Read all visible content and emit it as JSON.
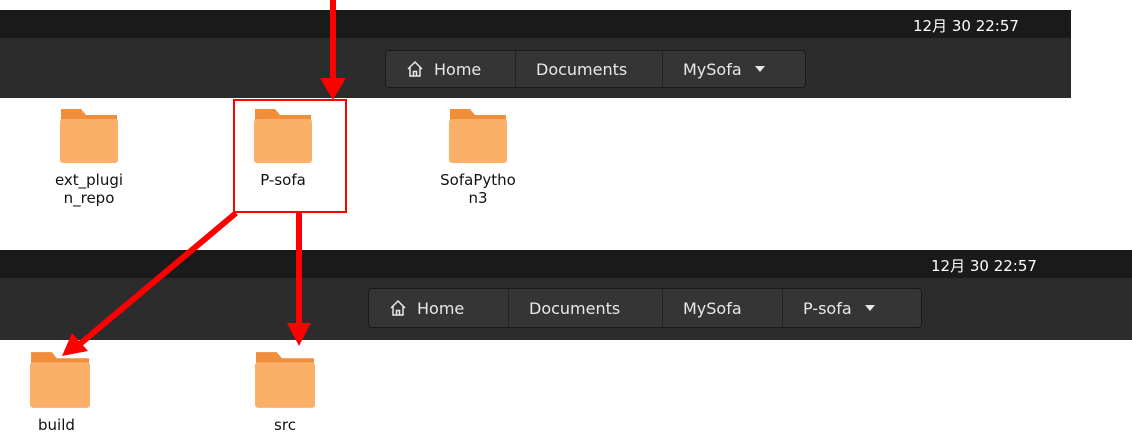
{
  "colors": {
    "folder_tab": "#f08e3b",
    "folder_body": "#fbb069",
    "annotation": "#ff0000",
    "topbar": "#1a1a1a",
    "headerbar": "#2c2c2c"
  },
  "top_window": {
    "clock": "12月 30 22:57",
    "path": [
      {
        "label": "Home",
        "icon": "home-icon"
      },
      {
        "label": "Documents"
      },
      {
        "label": "MySofa",
        "dropdown": true
      }
    ],
    "folders": [
      {
        "label": "ext_plugin_repo"
      },
      {
        "label": "P-sofa",
        "highlighted": true
      },
      {
        "label": "SofaPython3"
      }
    ]
  },
  "bottom_window": {
    "clock": "12月 30 22:57",
    "path": [
      {
        "label": "Home",
        "icon": "home-icon"
      },
      {
        "label": "Documents"
      },
      {
        "label": "MySofa"
      },
      {
        "label": "P-sofa",
        "dropdown": true
      }
    ],
    "folders": [
      {
        "label": "build"
      },
      {
        "label": "src"
      }
    ]
  }
}
